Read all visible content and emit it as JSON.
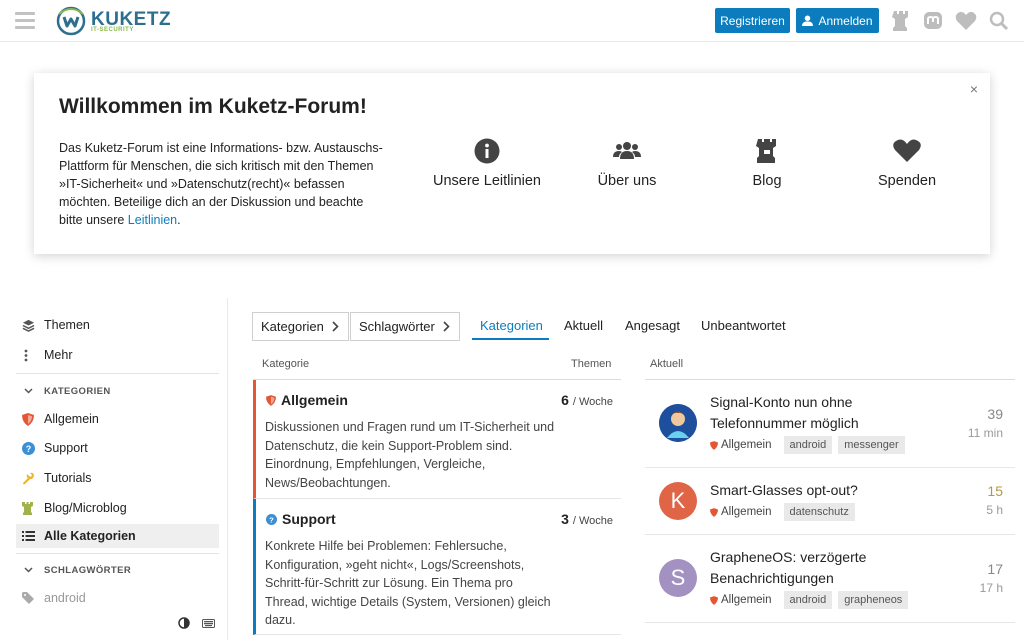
{
  "header": {
    "logo_text": "KUKETZ",
    "logo_sub": "IT-SECURITY",
    "register_label": "Registrieren",
    "login_label": "Anmelden",
    "icons": [
      "menu-icon",
      "chess-rook-icon",
      "mastodon-icon",
      "heart-icon",
      "search-icon"
    ],
    "accent": "#0b7dbe"
  },
  "banner": {
    "title": "Willkommen im Kuketz-Forum!",
    "close": "×",
    "text": "Das Kuketz-Forum ist eine Informations- bzw. Austauschs-Plattform für Menschen, die sich kritisch mit den Themen »IT-Sicherheit« und »Datenschutz(recht)« befassen möchten. Beteilige dich an der Diskussion und beachte bitte unsere ",
    "text_link": "Leitlinien",
    "text_end": ".",
    "links": [
      {
        "label": "Unsere Leitlinien",
        "icon": "info-circle-icon"
      },
      {
        "label": "Über uns",
        "icon": "users-icon"
      },
      {
        "label": "Blog",
        "icon": "chess-rook-icon"
      },
      {
        "label": "Spenden",
        "icon": "heart-icon"
      }
    ]
  },
  "sidebar": {
    "items_top": [
      {
        "label": "Themen",
        "icon": "layers-icon"
      },
      {
        "label": "Mehr",
        "icon": "ellipsis-vertical-icon"
      }
    ],
    "section_categories": "KATEGORIEN",
    "categories": [
      {
        "label": "Allgemein",
        "icon": "shield-icon"
      },
      {
        "label": "Support",
        "icon": "question-circle-icon"
      },
      {
        "label": "Tutorials",
        "icon": "wrench-icon"
      },
      {
        "label": "Blog/Microblog",
        "icon": "rook-icon"
      },
      {
        "label": "Alle Kategorien",
        "icon": "list-icon"
      }
    ],
    "section_tags": "SCHLAGWÖRTER",
    "tags": [
      {
        "label": "android",
        "icon": "tag-icon"
      }
    ]
  },
  "nav": {
    "dropdowns": [
      "Kategorien",
      "Schlagwörter"
    ],
    "tabs": [
      "Kategorien",
      "Aktuell",
      "Angesagt",
      "Unbeantwortet"
    ],
    "active_tab": "Kategorien"
  },
  "categories_table": {
    "col_category": "Kategorie",
    "col_topics": "Themen",
    "rows": [
      {
        "name": "Allgemein",
        "color": "#e45735",
        "description": "Diskussionen und Fragen rund um IT-Sicherheit und Datenschutz, die kein Support-Problem sind. Einordnung, Empfehlungen, Vergleiche, News/Beobachtungen.",
        "count": "6",
        "per": "/ Woche"
      },
      {
        "name": "Support",
        "color": "#0b7dbe",
        "description": "Konkrete Hilfe bei Problemen: Fehlersuche, Konfiguration, »geht nicht«, Logs/Screenshots, Schritt-für-Schritt zur Lösung. Ein Thema pro Thread, wichtige Details (System, Versionen) gleich dazu.",
        "count": "3",
        "per": "/ Woche"
      }
    ]
  },
  "topics": {
    "col_latest": "Aktuell",
    "items": [
      {
        "title": "Signal-Konto nun ohne Telefonnummer möglich",
        "category": "Allgemein",
        "tags": [
          "android",
          "messenger"
        ],
        "count": "39",
        "age": "11 min",
        "avatar_letter": "",
        "avatar_color": "#3b6fb6",
        "count_color": "#888888"
      },
      {
        "title": "Smart-Glasses opt-out?",
        "category": "Allgemein",
        "tags": [
          "datenschutz"
        ],
        "count": "15",
        "age": "5 h",
        "avatar_letter": "K",
        "avatar_color": "#e06547",
        "count_color": "#b39a43"
      },
      {
        "title": "GrapheneOS: verzögerte Benachrichtigungen",
        "category": "Allgemein",
        "tags": [
          "android",
          "grapheneos"
        ],
        "count": "17",
        "age": "17 h",
        "avatar_letter": "S",
        "avatar_color": "#a391c2",
        "count_color": "#888888"
      }
    ]
  }
}
